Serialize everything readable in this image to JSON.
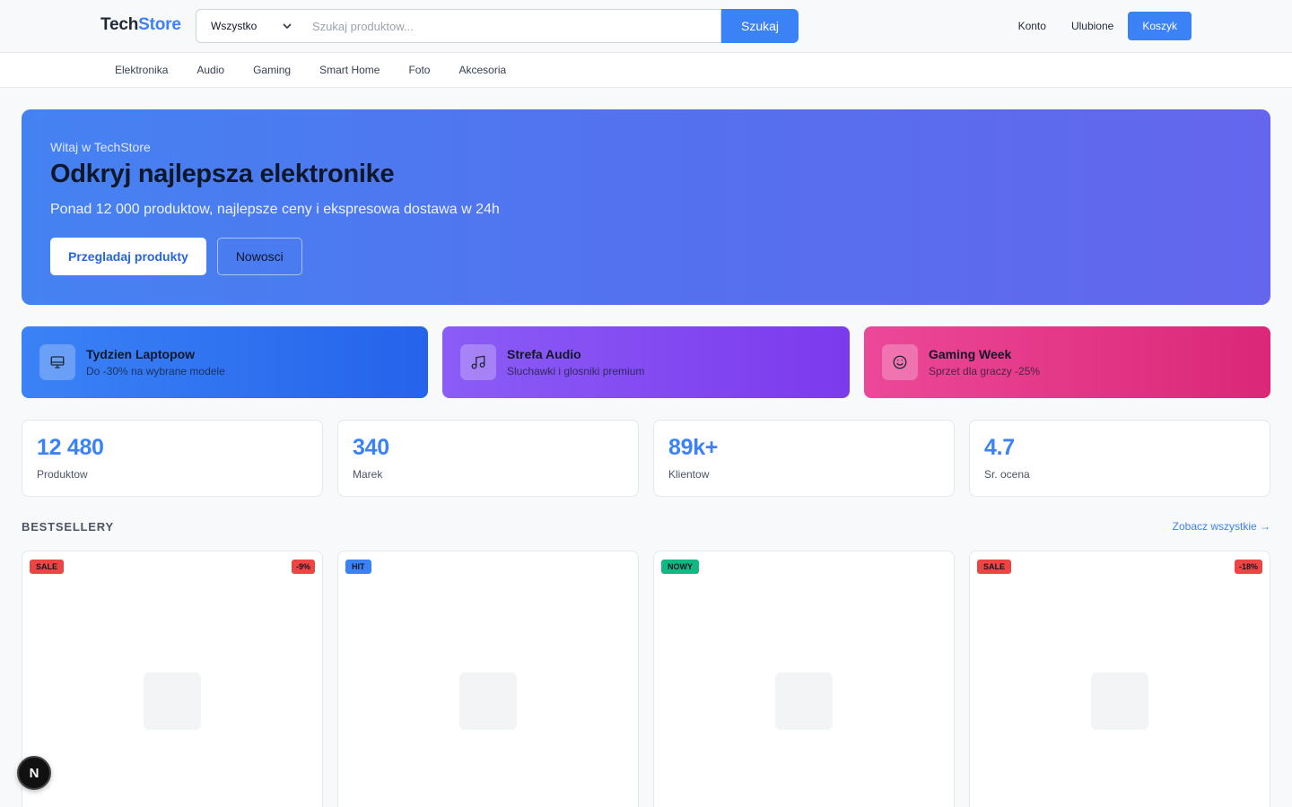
{
  "header": {
    "logo_part1": "Tech",
    "logo_part2": "Store",
    "search_category": "Wszystko",
    "search_placeholder": "Szukaj produktow...",
    "search_button": "Szukaj",
    "links": {
      "account": "Konto",
      "favorites": "Ulubione",
      "cart": "Koszyk"
    }
  },
  "categories": [
    "Elektronika",
    "Audio",
    "Gaming",
    "Smart Home",
    "Foto",
    "Akcesoria"
  ],
  "hero": {
    "welcome": "Witaj w TechStore",
    "headline": "Odkryj najlepsza elektronike",
    "subtitle": "Ponad 12 000 produktow, najlepsze ceny i ekspresowa dostawa w 24h",
    "primary_button": "Przegladaj produkty",
    "secondary_button": "Nowosci"
  },
  "promos": [
    {
      "title": "Tydzien Laptopow",
      "subtitle": "Do -30% na wybrane modele",
      "icon": "monitor-icon",
      "color": "#3b82f6"
    },
    {
      "title": "Strefa Audio",
      "subtitle": "Sluchawki i glosniki premium",
      "icon": "music-note-icon",
      "color": "#8b5cf6"
    },
    {
      "title": "Gaming Week",
      "subtitle": "Sprzet dla graczy -25%",
      "icon": "smiley-icon",
      "color": "#ec4899"
    }
  ],
  "stats": [
    {
      "value": "12 480",
      "label": "Produktow"
    },
    {
      "value": "340",
      "label": "Marek"
    },
    {
      "value": "89k+",
      "label": "Klientow"
    },
    {
      "value": "4.7",
      "label": "Sr. ocena"
    }
  ],
  "bestsellers": {
    "title": "BESTSELLERY",
    "see_all": "Zobacz wszystkie →",
    "products": [
      {
        "badge": "SALE",
        "discount": "-9%"
      },
      {
        "badge": "HIT",
        "discount": ""
      },
      {
        "badge": "NOWY",
        "discount": ""
      },
      {
        "badge": "SALE",
        "discount": "-18%"
      }
    ]
  },
  "fab_label": "N",
  "colors": {
    "accent": "#3b82f6",
    "sale": "#ef4444",
    "new": "#10b981"
  }
}
